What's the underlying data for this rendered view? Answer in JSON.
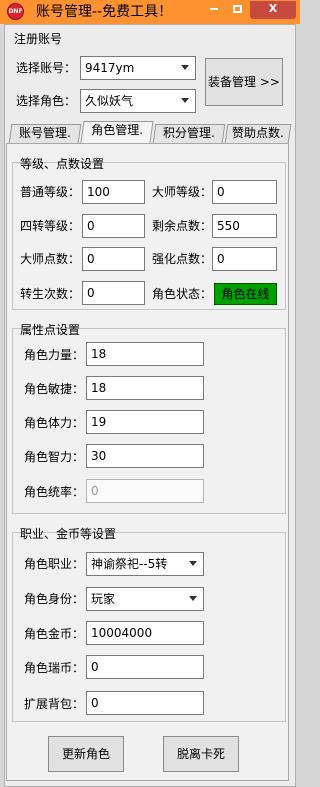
{
  "window": {
    "app_icon_text": "DNF",
    "title": "账号管理--免费工具！",
    "close_glyph": "X"
  },
  "register": {
    "section_title": "注册账号",
    "account_label": "选择账号：",
    "account_value": "9417ym",
    "role_label": "选择角色：",
    "role_value": "久似妖气",
    "equip_button": "装备管理 >>"
  },
  "tabs": [
    {
      "label": "账号管理."
    },
    {
      "label": "角色管理."
    },
    {
      "label": "积分管理."
    },
    {
      "label": "赞助点数."
    }
  ],
  "level_section": {
    "title": "等级、点数设置",
    "normal_level_label": "普通等级：",
    "normal_level": "100",
    "master_level_label": "大师等级：",
    "master_level": "0",
    "fourth_level_label": "四转等级：",
    "fourth_level": "0",
    "remaining_points_label": "剩余点数：",
    "remaining_points": "550",
    "master_points_label": "大师点数：",
    "master_points": "0",
    "enhance_points_label": "强化点数：",
    "enhance_points": "0",
    "rebirth_label": "转生次数：",
    "rebirth_count": "0",
    "role_status_label": "角色状态：",
    "role_status": "角色在线"
  },
  "attr_section": {
    "title": "属性点设置",
    "strength_label": "角色力量：",
    "strength": "18",
    "agility_label": "角色敏捷：",
    "agility": "18",
    "stamina_label": "角色体力：",
    "stamina": "19",
    "intellect_label": "角色智力：",
    "intellect": "30",
    "command_label": "角色统率：",
    "command": "0"
  },
  "job_section": {
    "title": "职业、金币等设置",
    "job_label": "角色职业：",
    "job_value": "神谕祭祀--5转",
    "identity_label": "角色身份：",
    "identity_value": "玩家",
    "gold_label": "角色金币：",
    "gold": "10004000",
    "rui_coin_label": "角色瑞币：",
    "rui_coin": "0",
    "bag_label": "扩展背包：",
    "bag": "0"
  },
  "actions": {
    "update_button": "更新角色",
    "unstuck_button": "脱离卡死"
  },
  "colors": {
    "titlebar": "#ff9230",
    "close_button": "#c74a3f",
    "status_online": "#00a000"
  }
}
